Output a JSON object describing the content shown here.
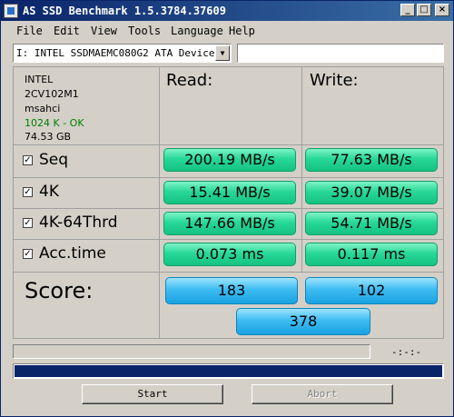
{
  "window": {
    "title": "AS SSD Benchmark 1.5.3784.37609",
    "minimize_glyph": "_",
    "maximize_glyph": "□",
    "close_glyph": "×"
  },
  "menu": [
    "File",
    "Edit",
    "View",
    "Tools",
    "Language",
    "Help"
  ],
  "device": {
    "selected": "I: INTEL SSDMAEMC080G2 ATA Device",
    "dropdown_glyph": "▼",
    "path_value": ""
  },
  "drive_info": {
    "vendor": "INTEL",
    "firmware": "2CV102M1",
    "driver": "msahci",
    "alignment": "1024 K - OK",
    "capacity": "74.53 GB"
  },
  "headers": {
    "read": "Read:",
    "write": "Write:"
  },
  "check_glyph": "✓",
  "rows": [
    {
      "label": "Seq",
      "checked": true,
      "read": "200.19 MB/s",
      "write": "77.63 MB/s"
    },
    {
      "label": "4K",
      "checked": true,
      "read": "15.41 MB/s",
      "write": "39.07 MB/s"
    },
    {
      "label": "4K-64Thrd",
      "checked": true,
      "read": "147.66 MB/s",
      "write": "54.71 MB/s"
    },
    {
      "label": "Acc.time",
      "checked": true,
      "read": "0.073 ms",
      "write": "0.117 ms"
    }
  ],
  "score": {
    "label": "Score:",
    "read": "183",
    "write": "102",
    "total": "378"
  },
  "status": {
    "time": "-:-:-",
    "progress": 1.0
  },
  "buttons": {
    "start": "Start",
    "abort": "Abort"
  },
  "colors": {
    "title_bar": "#0a246a",
    "result_green": "#27d898",
    "score_blue": "#3dbcf2",
    "ok_text": "#008000",
    "progress": "#0a246a"
  }
}
